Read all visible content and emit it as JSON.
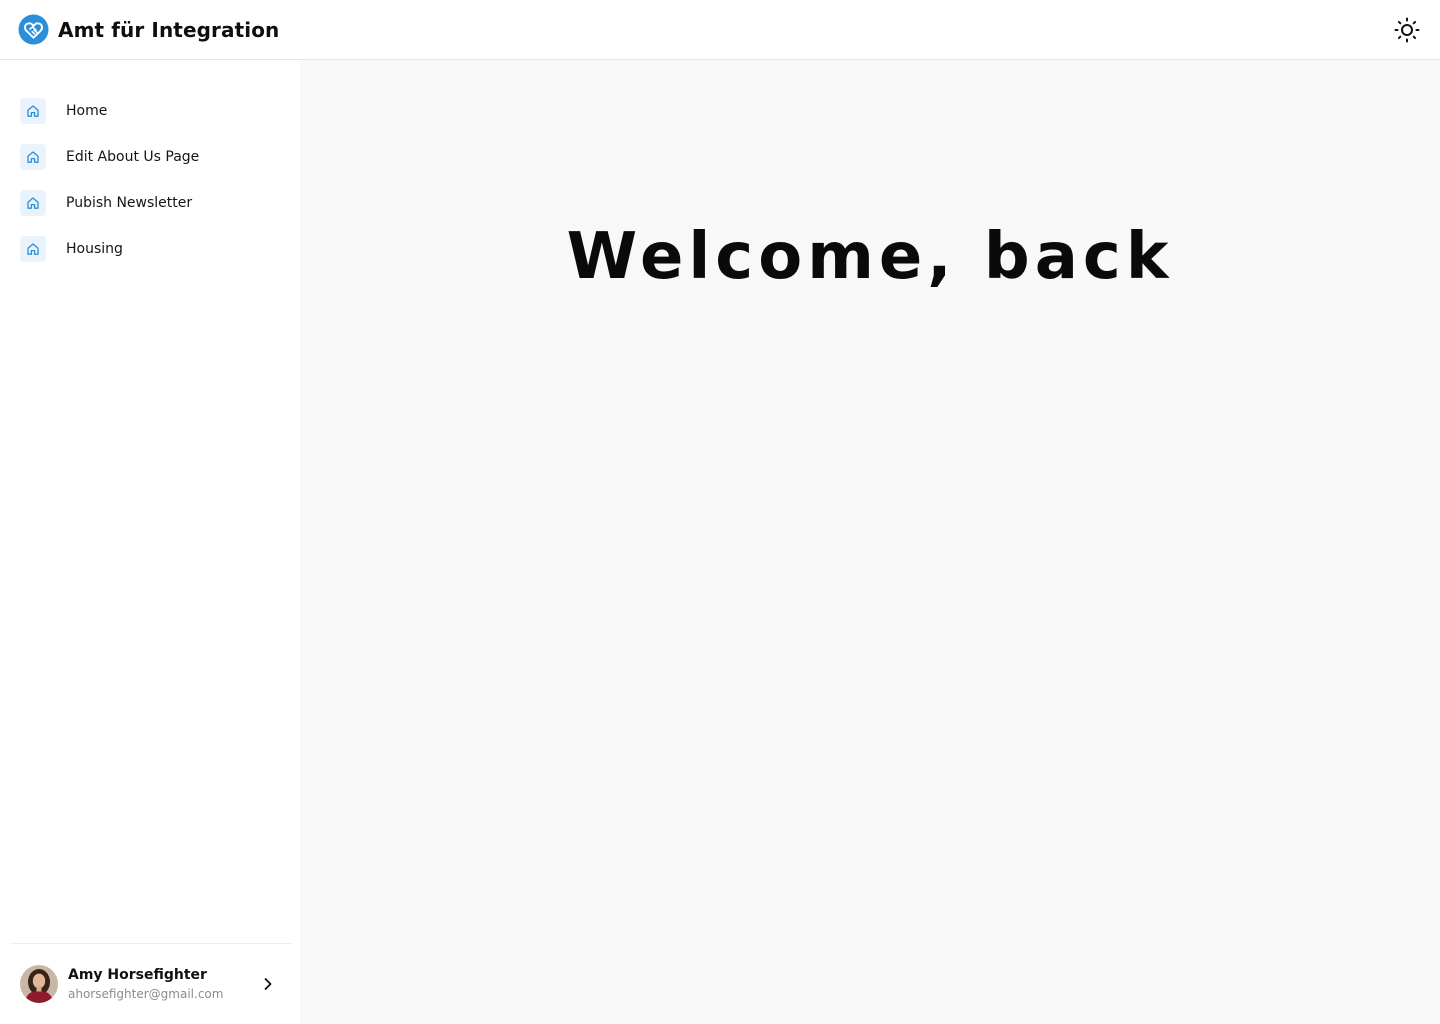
{
  "header": {
    "title": "Amt für Integration",
    "logo_icon": "heart-handshake-icon",
    "theme_toggle_icon": "sun-icon",
    "accent_color": "#2a8fd8"
  },
  "sidebar": {
    "items": [
      {
        "label": "Home",
        "icon": "home-icon"
      },
      {
        "label": "Edit About Us Page",
        "icon": "home-icon"
      },
      {
        "label": "Pubish Newsletter",
        "icon": "home-icon"
      },
      {
        "label": "Housing",
        "icon": "home-icon"
      }
    ],
    "user": {
      "name": "Amy Horsefighter",
      "email": "ahorsefighter@gmail.com",
      "chevron_icon": "chevron-right-icon"
    }
  },
  "main": {
    "heading": "Welcome, back"
  }
}
